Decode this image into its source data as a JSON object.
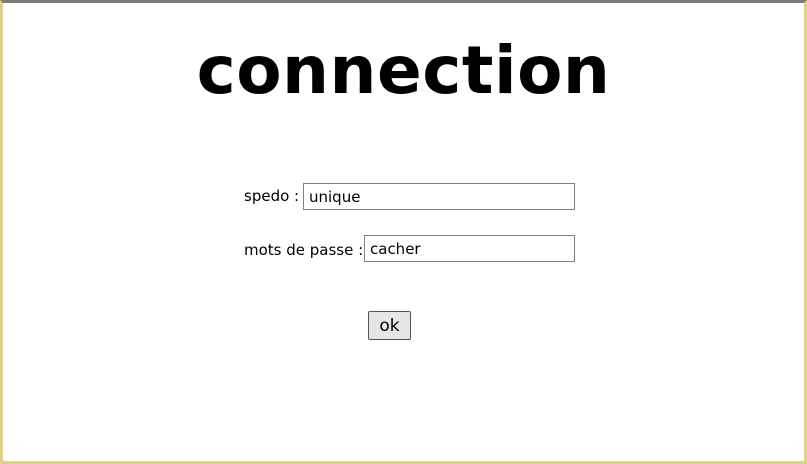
{
  "page": {
    "title": "connection"
  },
  "form": {
    "username_label": "spedo :",
    "username_value": "unique",
    "password_label": "mots de passe :",
    "password_value": "cacher",
    "submit_label": "ok"
  },
  "colors": {
    "frame_border": "#e2cf85",
    "field_border": "#7f7f7f",
    "button_bg": "#e6e6e6"
  }
}
